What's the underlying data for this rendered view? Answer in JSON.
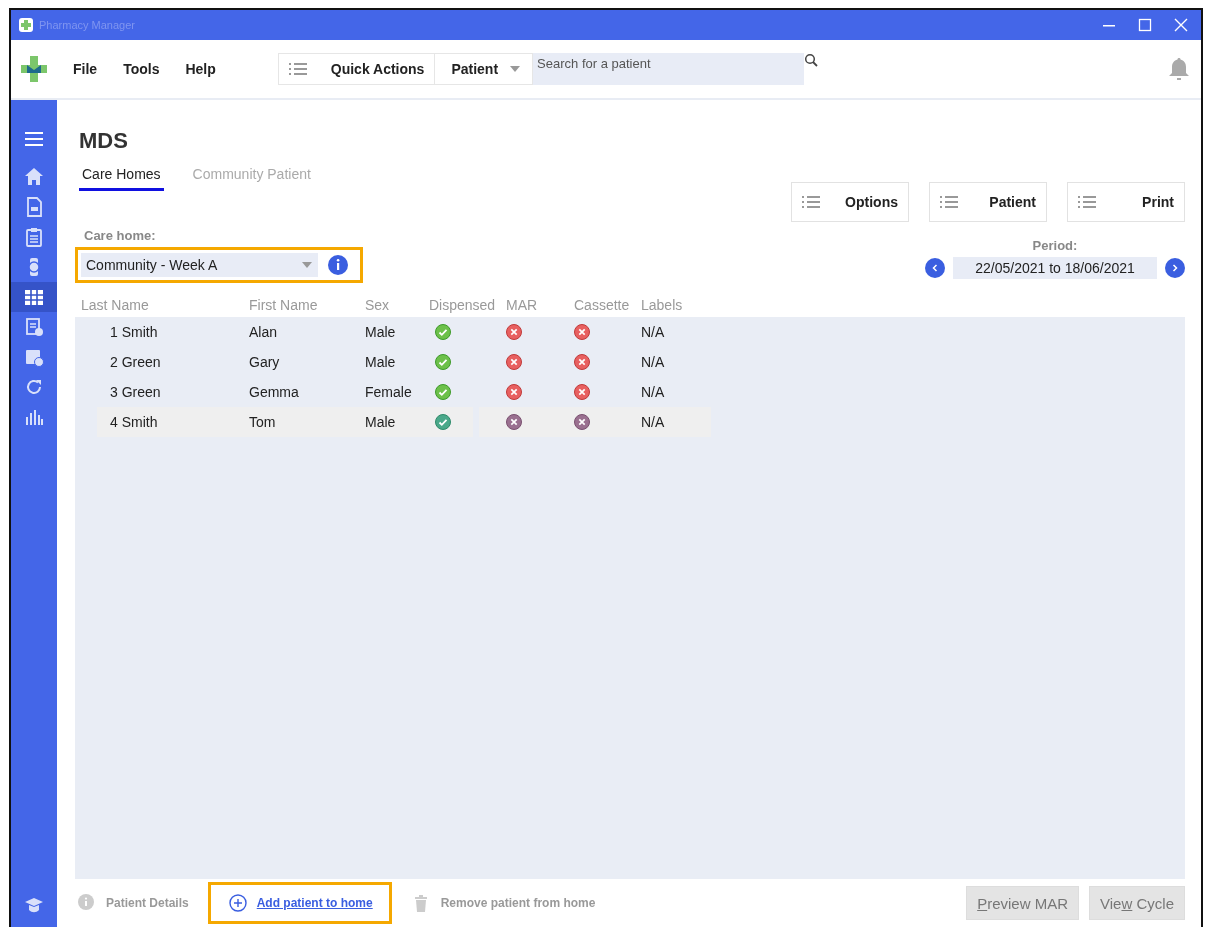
{
  "window": {
    "title": "Pharmacy Manager"
  },
  "menu": [
    "File",
    "Tools",
    "Help"
  ],
  "toolbar": {
    "quick_actions": "Quick Actions",
    "search_scope": "Patient",
    "search": {
      "placeholder": "Search for a patient"
    }
  },
  "sidebar": {
    "items": [
      {
        "kind": "menu",
        "selected": false
      },
      {
        "kind": "home",
        "selected": false
      },
      {
        "kind": "rx",
        "selected": false
      },
      {
        "kind": "clipboard",
        "selected": false
      },
      {
        "kind": "watch",
        "selected": false
      },
      {
        "kind": "grid",
        "selected": true
      },
      {
        "kind": "doc",
        "selected": false
      },
      {
        "kind": "calendar",
        "selected": false
      },
      {
        "kind": "refresh",
        "selected": false
      },
      {
        "kind": "chart",
        "selected": false
      }
    ],
    "bottom": {
      "kind": "grad",
      "selected": false
    }
  },
  "page": {
    "title": "MDS"
  },
  "tabs": [
    {
      "label": "Care Homes",
      "selected": true
    },
    {
      "label": "Community Patient",
      "selected": false
    }
  ],
  "actions": [
    "Options",
    "Patient",
    "Print"
  ],
  "care_home": {
    "label": "Care home:",
    "value": "Community - Week A",
    "highlighted": true
  },
  "period": {
    "label": "Period:",
    "value": "22/05/2021 to 18/06/2021"
  },
  "table": {
    "columns": [
      "Last Name",
      "First Name",
      "Sex",
      "Dispensed",
      "MAR",
      "Cassette",
      "Labels"
    ],
    "rows": [
      {
        "last_name": "1 Smith",
        "first_name": "Alan",
        "sex": "Male",
        "dispensed": true,
        "mar": false,
        "cassette": false,
        "labels": "N/A",
        "selected": false
      },
      {
        "last_name": "2 Green",
        "first_name": "Gary",
        "sex": "Male",
        "dispensed": true,
        "mar": false,
        "cassette": false,
        "labels": "N/A",
        "selected": false
      },
      {
        "last_name": "3 Green",
        "first_name": "Gemma",
        "sex": "Female",
        "dispensed": true,
        "mar": false,
        "cassette": false,
        "labels": "N/A",
        "selected": false
      },
      {
        "last_name": "4 Smith",
        "first_name": "Tom",
        "sex": "Male",
        "dispensed": true,
        "mar": false,
        "cassette": false,
        "labels": "N/A",
        "selected": true
      }
    ]
  },
  "footer": {
    "links": [
      {
        "kind": "info",
        "label": "Patient Details",
        "disabled": true,
        "highlighted": false
      },
      {
        "kind": "add",
        "label": "Add patient to home",
        "disabled": false,
        "highlighted": true
      },
      {
        "kind": "trash",
        "label": "Remove patient from home",
        "disabled": true,
        "highlighted": false
      }
    ],
    "buttons": [
      {
        "mnemonic": "P",
        "after": "review MAR",
        "disabled": true
      },
      {
        "before": "Vie",
        "mnemonic": "w",
        "after": " Cycle",
        "disabled": true
      }
    ]
  }
}
